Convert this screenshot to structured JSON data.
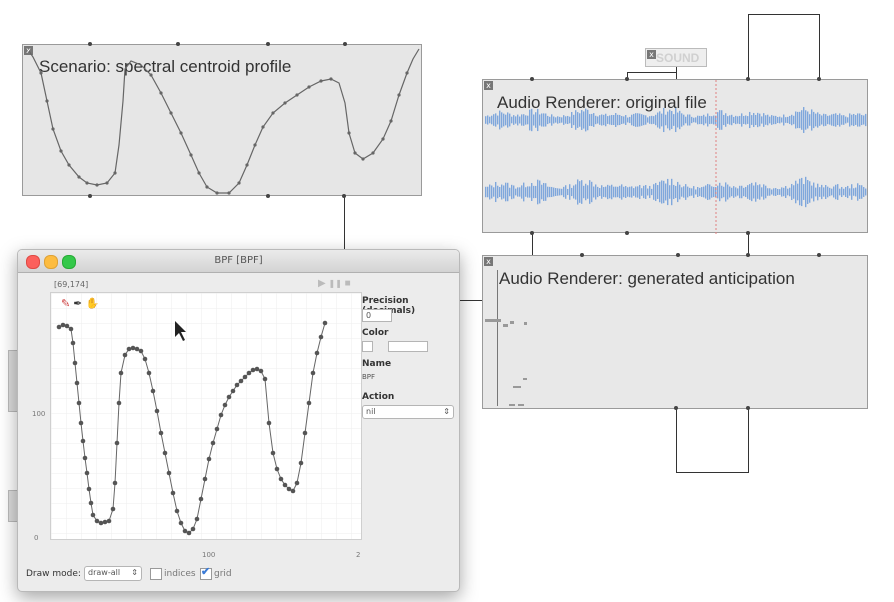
{
  "scenario_box": {
    "label": "Scenario: spectral centroid profile",
    "close": "x"
  },
  "sound_box": {
    "label": "SOUND",
    "close": "x"
  },
  "original_renderer": {
    "label": "Audio Renderer: original file",
    "close": "x"
  },
  "anticipation_renderer": {
    "label": "Audio Renderer: generated anticipation",
    "close": "x"
  },
  "bpf_window": {
    "title": "BPF [BPF]",
    "coords": "[69,174]",
    "controls": {
      "play": "▶",
      "pause": "❚❚",
      "stop": "■"
    },
    "tools": {
      "pencil": "✎",
      "pen": "✒",
      "hand": "✋"
    },
    "y_ticks": [
      "100",
      "0"
    ],
    "x_ticks": [
      "100",
      "2"
    ],
    "precision_label": "Precision (decimals)",
    "precision_value": "0",
    "color_label": "Color",
    "name_label": "Name",
    "name_value": "BPF",
    "action_label": "Action",
    "action_value": "nil",
    "draw_mode_label": "Draw mode:",
    "draw_mode_value": "draw-all",
    "indices_label": "indices",
    "indices_checked": false,
    "grid_label": "grid",
    "grid_checked": true
  },
  "colors": {
    "waveform": "#7fa7dc",
    "box_bg": "#e6e6e6",
    "curve": "#555555",
    "grid_check": "#3b7bd6"
  }
}
